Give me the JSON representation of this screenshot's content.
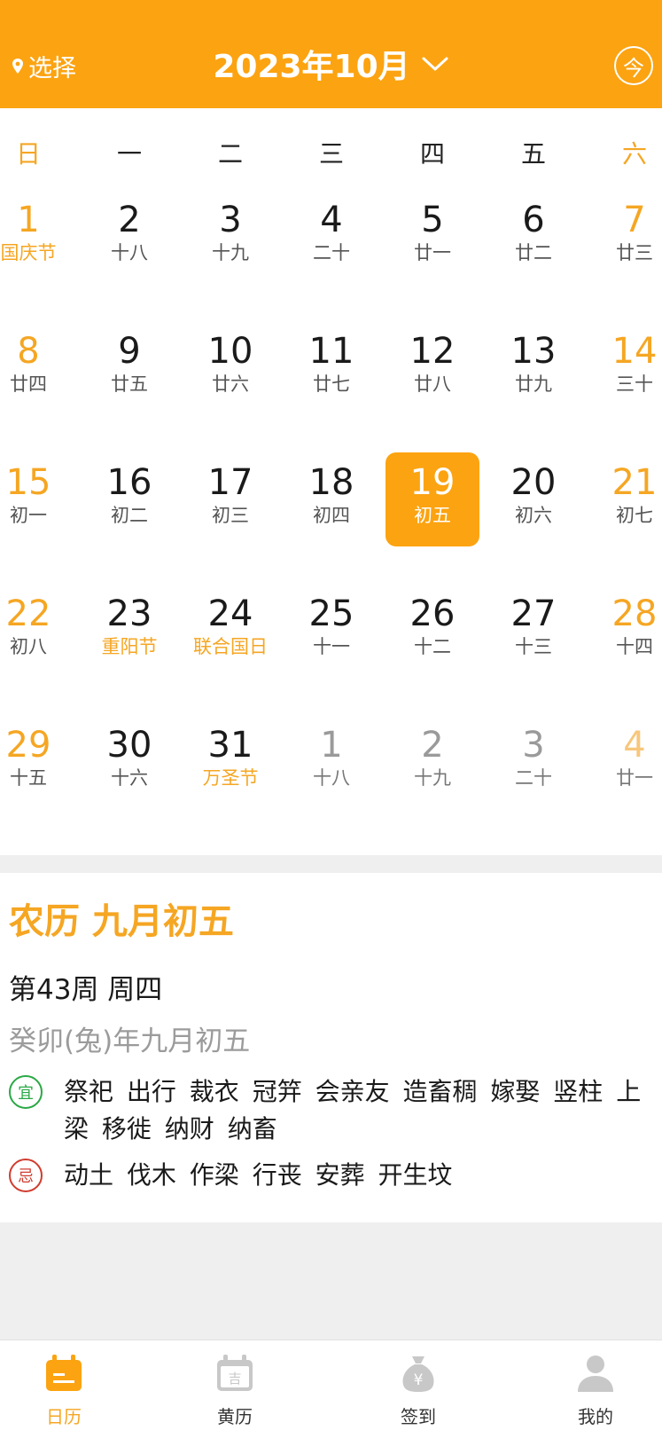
{
  "colors": {
    "accent": "#fca311",
    "festival": "#f5a623",
    "yi": "#2aa845",
    "ji": "#d03c2f"
  },
  "header": {
    "location_label": "选择",
    "month_title": "2023年10月",
    "today_label": "今"
  },
  "weekdays": [
    "日",
    "一",
    "二",
    "三",
    "四",
    "五",
    "六"
  ],
  "calendar": {
    "selected_day": "19",
    "weeks": [
      [
        {
          "day": "1",
          "lunar": "国庆节",
          "festival": true
        },
        {
          "day": "2",
          "lunar": "十八"
        },
        {
          "day": "3",
          "lunar": "十九"
        },
        {
          "day": "4",
          "lunar": "二十"
        },
        {
          "day": "5",
          "lunar": "廿一"
        },
        {
          "day": "6",
          "lunar": "廿二"
        },
        {
          "day": "7",
          "lunar": "廿三"
        }
      ],
      [
        {
          "day": "8",
          "lunar": "廿四"
        },
        {
          "day": "9",
          "lunar": "廿五"
        },
        {
          "day": "10",
          "lunar": "廿六"
        },
        {
          "day": "11",
          "lunar": "廿七"
        },
        {
          "day": "12",
          "lunar": "廿八"
        },
        {
          "day": "13",
          "lunar": "廿九"
        },
        {
          "day": "14",
          "lunar": "三十"
        }
      ],
      [
        {
          "day": "15",
          "lunar": "初一"
        },
        {
          "day": "16",
          "lunar": "初二"
        },
        {
          "day": "17",
          "lunar": "初三"
        },
        {
          "day": "18",
          "lunar": "初四"
        },
        {
          "day": "19",
          "lunar": "初五",
          "selected": true
        },
        {
          "day": "20",
          "lunar": "初六"
        },
        {
          "day": "21",
          "lunar": "初七"
        }
      ],
      [
        {
          "day": "22",
          "lunar": "初八"
        },
        {
          "day": "23",
          "lunar": "重阳节",
          "festival": true
        },
        {
          "day": "24",
          "lunar": "联合国日",
          "festival": true
        },
        {
          "day": "25",
          "lunar": "十一"
        },
        {
          "day": "26",
          "lunar": "十二"
        },
        {
          "day": "27",
          "lunar": "十三"
        },
        {
          "day": "28",
          "lunar": "十四"
        }
      ],
      [
        {
          "day": "29",
          "lunar": "十五"
        },
        {
          "day": "30",
          "lunar": "十六"
        },
        {
          "day": "31",
          "lunar": "万圣节",
          "festival": true
        },
        {
          "day": "1",
          "lunar": "十八",
          "other": true
        },
        {
          "day": "2",
          "lunar": "十九",
          "other": true
        },
        {
          "day": "3",
          "lunar": "二十",
          "other": true
        },
        {
          "day": "4",
          "lunar": "廿一",
          "other": true
        }
      ]
    ]
  },
  "info": {
    "lunar_title": "农历 九月初五",
    "week_line": "第43周 周四",
    "ganzhi": "癸卯(兔)年九月初五",
    "yi_badge": "宜",
    "yi_text": "祭祀 出行 裁衣 冠笄 会亲友 造畜稠 嫁娶 竖柱 上梁 移徙 纳财 纳畜",
    "ji_badge": "忌",
    "ji_text": "动土 伐木 作梁 行丧 安葬 开生坟"
  },
  "nav": {
    "items": [
      {
        "label": "日历",
        "icon": "calendar-icon",
        "active": true
      },
      {
        "label": "黄历",
        "icon": "almanac-icon"
      },
      {
        "label": "签到",
        "icon": "money-bag-icon"
      },
      {
        "label": "我的",
        "icon": "user-icon"
      }
    ]
  }
}
